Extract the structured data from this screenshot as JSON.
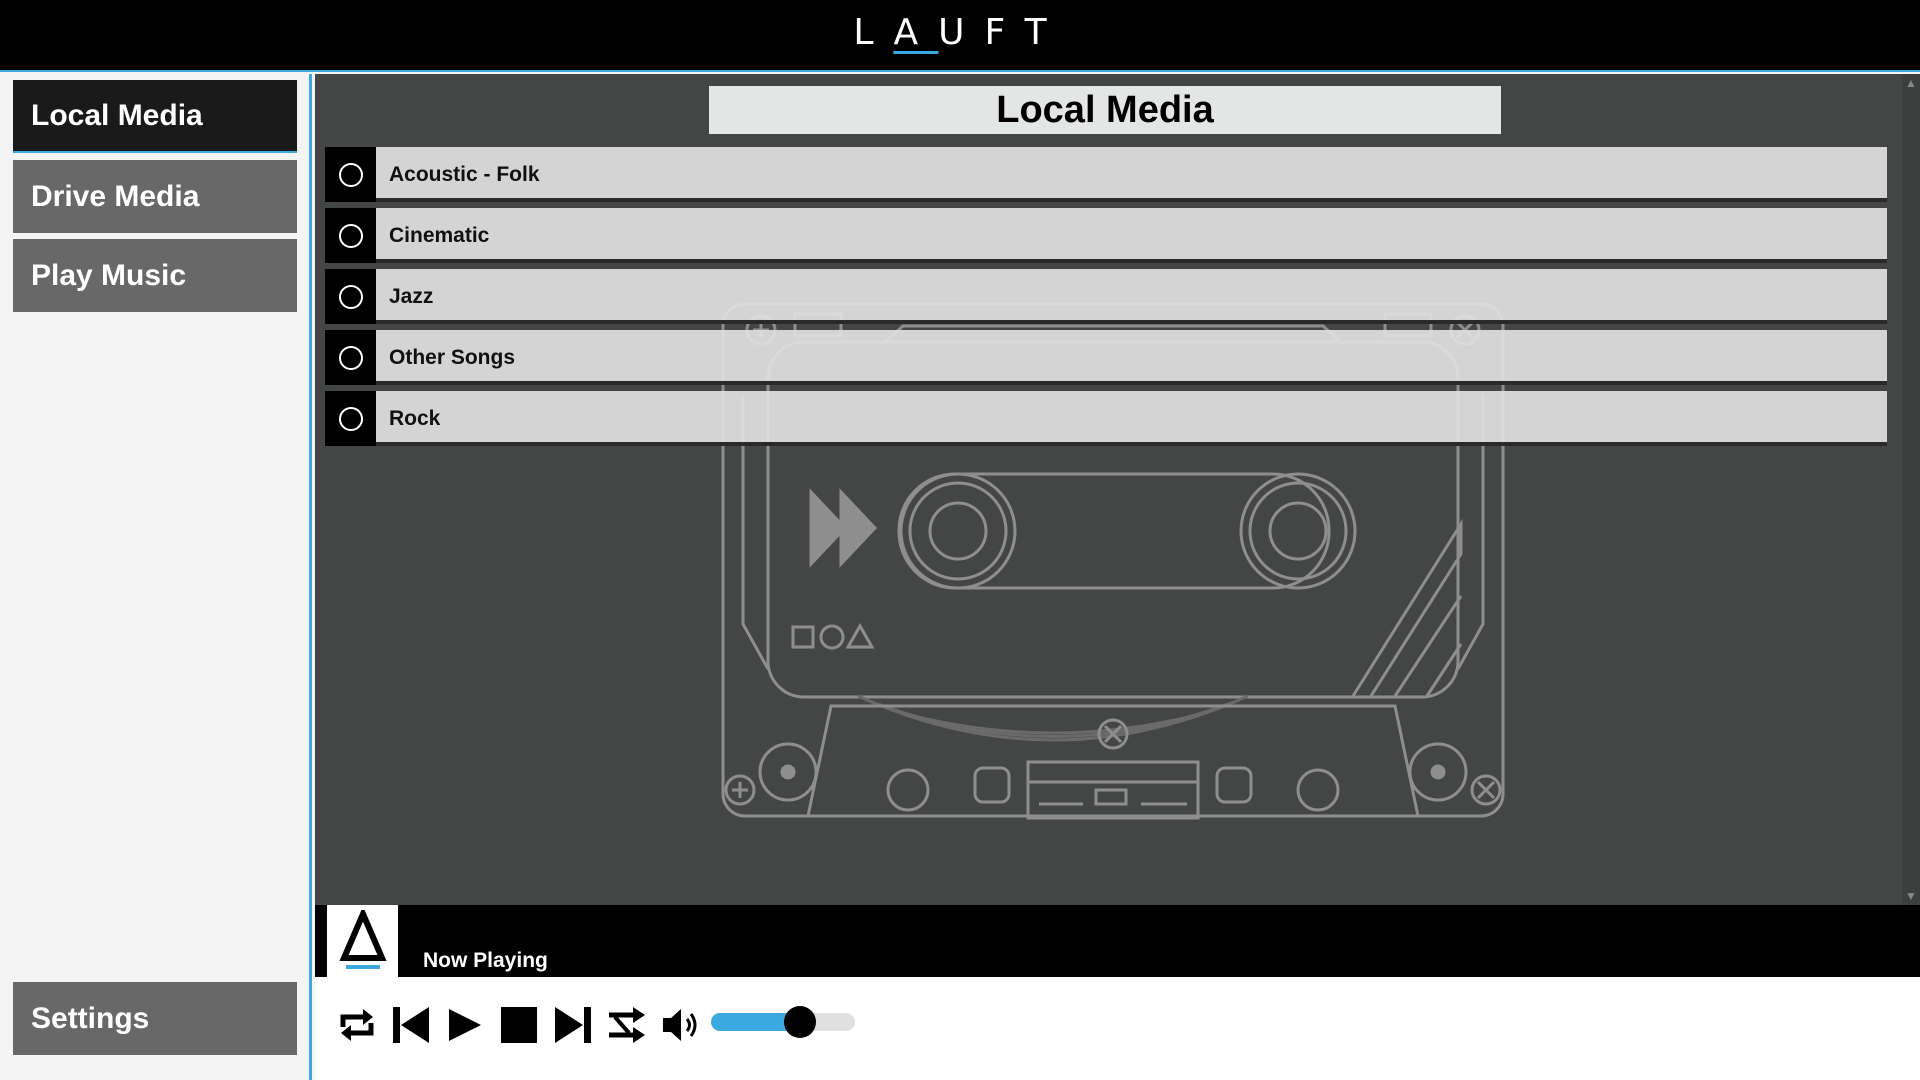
{
  "app": {
    "logo_text": "LAUFT"
  },
  "sidebar": {
    "items": [
      {
        "label": "Local Media",
        "active": true
      },
      {
        "label": "Drive Media",
        "active": false
      },
      {
        "label": "Play Music",
        "active": false
      }
    ],
    "settings_label": "Settings"
  },
  "main": {
    "title": "Local Media",
    "playlists": [
      {
        "label": "Acoustic - Folk",
        "selected": false
      },
      {
        "label": "Cinematic",
        "selected": false
      },
      {
        "label": "Jazz",
        "selected": false
      },
      {
        "label": "Other Songs",
        "selected": false
      },
      {
        "label": "Rock",
        "selected": false
      }
    ]
  },
  "now_playing": {
    "label": "Now Playing"
  },
  "controls": {
    "buttons": [
      "repeat-icon",
      "previous-icon",
      "play-icon",
      "stop-icon",
      "next-icon",
      "shuffle-icon",
      "volume-icon"
    ],
    "volume_percent": 62
  },
  "colors": {
    "accent": "#3aa9df",
    "panel_bg": "#444545",
    "nav_active": "#1a1a1a",
    "nav_inactive": "#686868"
  }
}
